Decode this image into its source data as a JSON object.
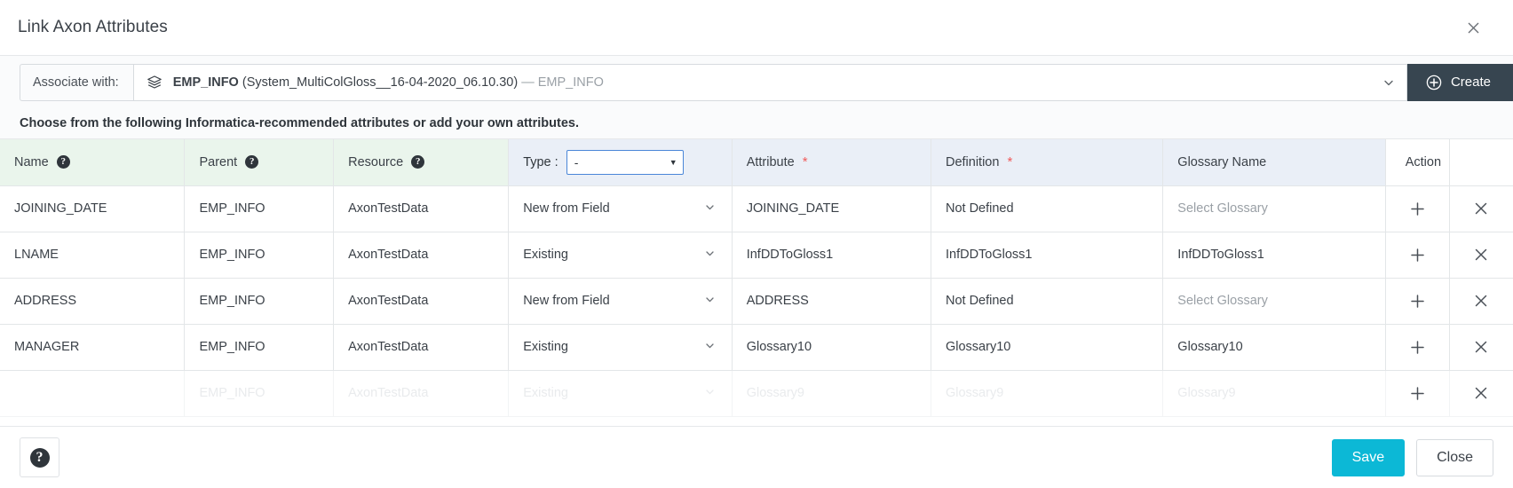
{
  "window": {
    "title": "Link Axon Attributes",
    "close_icon": "close-icon"
  },
  "associate": {
    "label": "Associate with:",
    "resource_icon": "layers-icon",
    "selected_bold": "EMP_INFO",
    "selected_paren": "(System_MultiColGloss__16-04-2020_06.10.30)",
    "selected_dash": "—",
    "selected_suffix": "EMP_INFO",
    "caret_icon": "chevron-down-icon",
    "create_label": "Create",
    "create_icon": "plus-circle-icon",
    "create_bg": "#374550"
  },
  "instruction": "Choose from the following Informatica-recommended attributes or add your own attributes.",
  "table": {
    "headers": {
      "name": "Name",
      "parent": "Parent",
      "resource": "Resource",
      "type_label": "Type :",
      "type_value": "-",
      "attribute": "Attribute",
      "definition": "Definition",
      "glossary_name": "Glossary Name",
      "action": "Action"
    },
    "header_colors": {
      "green": "#eaf5ec",
      "blue": "#eaeff7",
      "white": "#ffffff",
      "required_asterisk": "#f05a5a",
      "select_border": "#4a86d8"
    },
    "glossary_placeholder": "Select Glossary",
    "rows": [
      {
        "name": "JOINING_DATE",
        "parent": "EMP_INFO",
        "resource": "AxonTestData",
        "type": "New from Field",
        "attribute": "JOINING_DATE",
        "definition": "Not Defined",
        "glossary": "Select Glossary",
        "glossary_is_placeholder": true,
        "add_icon": "plus-icon",
        "remove_icon": "close-icon"
      },
      {
        "name": "LNAME",
        "parent": "EMP_INFO",
        "resource": "AxonTestData",
        "type": "Existing",
        "attribute": "InfDDToGloss1",
        "definition": "InfDDToGloss1",
        "glossary": "InfDDToGloss1",
        "glossary_is_placeholder": false,
        "add_icon": "plus-icon",
        "remove_icon": "close-icon"
      },
      {
        "name": "ADDRESS",
        "parent": "EMP_INFO",
        "resource": "AxonTestData",
        "type": "New from Field",
        "attribute": "ADDRESS",
        "definition": "Not Defined",
        "glossary": "Select Glossary",
        "glossary_is_placeholder": true,
        "add_icon": "plus-icon",
        "remove_icon": "close-icon"
      },
      {
        "name": "MANAGER",
        "parent": "EMP_INFO",
        "resource": "AxonTestData",
        "type": "Existing",
        "attribute": "Glossary10",
        "definition": "Glossary10",
        "glossary": "Glossary10",
        "glossary_is_placeholder": false,
        "add_icon": "plus-icon",
        "remove_icon": "close-icon"
      },
      {
        "name": "",
        "parent": "EMP_INFO",
        "resource": "AxonTestData",
        "type": "Existing",
        "attribute": "Glossary9",
        "definition": "Glossary9",
        "glossary": "Glossary9",
        "glossary_is_placeholder": false,
        "add_icon": "plus-icon",
        "remove_icon": "close-icon"
      }
    ]
  },
  "footer": {
    "help_icon": "question-mark-icon",
    "save_label": "Save",
    "close_label": "Close",
    "save_color": "#0cb8d6"
  }
}
